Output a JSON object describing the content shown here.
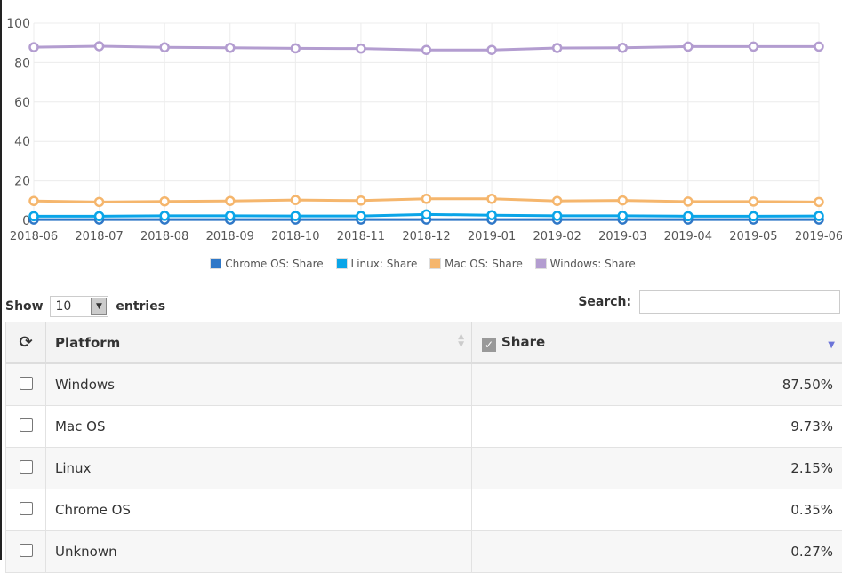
{
  "chart_data": {
    "type": "line",
    "categories": [
      "2018-06",
      "2018-07",
      "2018-08",
      "2018-09",
      "2018-10",
      "2018-11",
      "2018-12",
      "2019-01",
      "2019-02",
      "2019-03",
      "2019-04",
      "2019-05",
      "2019-06"
    ],
    "ylim": [
      0,
      100
    ],
    "yticks": [
      0,
      20,
      40,
      60,
      80,
      100
    ],
    "grid": true,
    "legend": "bottom",
    "series": [
      {
        "name": "Chrome OS: Share",
        "color": "#2f78c8",
        "values": [
          0.4,
          0.4,
          0.4,
          0.4,
          0.4,
          0.4,
          0.4,
          0.4,
          0.4,
          0.4,
          0.4,
          0.4,
          0.4
        ]
      },
      {
        "name": "Linux: Share",
        "color": "#0aa5e8",
        "values": [
          2.1,
          2.1,
          2.3,
          2.3,
          2.2,
          2.2,
          3.0,
          2.6,
          2.3,
          2.3,
          2.1,
          2.1,
          2.2
        ]
      },
      {
        "name": "Mac OS: Share",
        "color": "#f5b66d",
        "values": [
          9.8,
          9.3,
          9.6,
          9.8,
          10.3,
          10.0,
          10.9,
          10.9,
          9.8,
          10.1,
          9.5,
          9.5,
          9.3
        ]
      },
      {
        "name": "Windows: Share",
        "color": "#b39dd0",
        "values": [
          87.8,
          88.3,
          87.7,
          87.5,
          87.2,
          87.1,
          86.4,
          86.4,
          87.4,
          87.5,
          88.1,
          88.1,
          88.1
        ]
      }
    ]
  },
  "controls": {
    "show_label": "Show",
    "entries_value": "10",
    "entries_label": "entries",
    "search_label": "Search:",
    "search_value": ""
  },
  "table": {
    "headers": {
      "platform": "Platform",
      "share": "Share"
    },
    "rows": [
      {
        "platform": "Windows",
        "share": "87.50%"
      },
      {
        "platform": "Mac OS",
        "share": "9.73%"
      },
      {
        "platform": "Linux",
        "share": "2.15%"
      },
      {
        "platform": "Chrome OS",
        "share": "0.35%"
      },
      {
        "platform": "Unknown",
        "share": "0.27%"
      }
    ]
  }
}
